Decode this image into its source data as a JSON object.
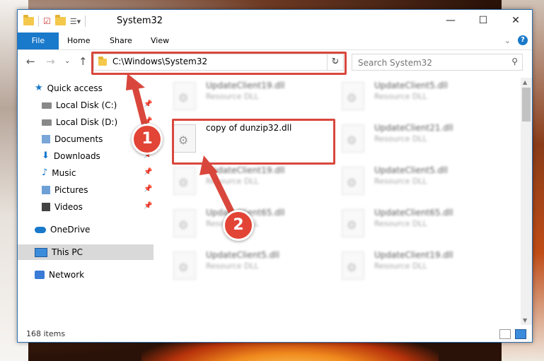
{
  "window": {
    "title": "System32",
    "controls": {
      "minimize": "—",
      "maximize": "☐",
      "close": "✕"
    }
  },
  "ribbon": {
    "tabs": [
      "File",
      "Home",
      "Share",
      "View"
    ]
  },
  "navigation": {
    "address": "C:\\Windows\\System32",
    "search_placeholder": "Search System32"
  },
  "sidebar": {
    "items": [
      {
        "label": "Quick access",
        "icon": "star-icon"
      },
      {
        "label": "Local Disk (C:)",
        "icon": "drive-icon",
        "pinned": true
      },
      {
        "label": "Local Disk (D:)",
        "icon": "drive-icon",
        "pinned": true
      },
      {
        "label": "Documents",
        "icon": "documents-icon",
        "pinned": true
      },
      {
        "label": "Downloads",
        "icon": "downloads-icon",
        "pinned": true
      },
      {
        "label": "Music",
        "icon": "music-icon",
        "pinned": true
      },
      {
        "label": "Pictures",
        "icon": "pictures-icon",
        "pinned": true
      },
      {
        "label": "Videos",
        "icon": "videos-icon",
        "pinned": true
      },
      {
        "label": "OneDrive",
        "icon": "onedrive-icon"
      },
      {
        "label": "This PC",
        "icon": "this-pc-icon",
        "selected": true
      },
      {
        "label": "Network",
        "icon": "network-icon"
      }
    ]
  },
  "files": [
    {
      "name": "UpdateClient19.dll",
      "type": "Resource DLL"
    },
    {
      "name": "UpdateClient5.dll",
      "type": "Resource DLL"
    },
    {
      "name": "copy of dunzip32.dll",
      "type": ""
    },
    {
      "name": "UpdateClient21.dll",
      "type": "Resource DLL"
    },
    {
      "name": "UpdateClient19.dll",
      "type": "Resource DLL"
    },
    {
      "name": "UpdateClient5.dll",
      "type": "Resource DLL"
    },
    {
      "name": "UpdateClient65.dll",
      "type": "Resource DLL"
    },
    {
      "name": "UpdateClient65.dll",
      "type": "Resource DLL"
    },
    {
      "name": "UpdateClient5.dll",
      "type": "Resource DLL"
    },
    {
      "name": "UpdateClient19.dll",
      "type": "Resource DLL"
    }
  ],
  "status": {
    "item_count": "168 items"
  },
  "annotations": {
    "step1": "1",
    "step2": "2",
    "color": "#d9473c"
  }
}
